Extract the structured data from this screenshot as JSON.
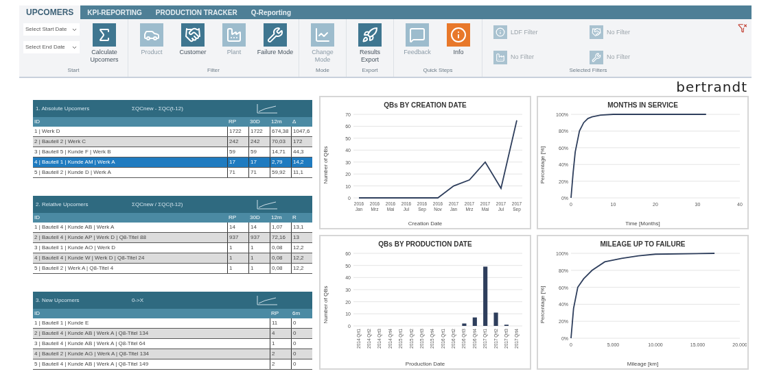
{
  "ribbon": {
    "tabs": [
      {
        "label": "UPCOMERS",
        "selected": true
      },
      {
        "label": "KPI-REPORTING",
        "selected": false
      },
      {
        "label": "PRODUCTION TRACKER",
        "selected": false
      },
      {
        "label": "Q-Reporting",
        "selected": false
      }
    ],
    "groups": [
      {
        "label": "Start",
        "dropdowns": [
          "Select Start Date",
          "Select End Date"
        ],
        "buttons": [
          {
            "label": "Calculate Upcomers",
            "disabled": false
          }
        ]
      },
      {
        "label": "Filter",
        "buttons": [
          {
            "label": "Product",
            "disabled": true
          },
          {
            "label": "Customer",
            "disabled": false
          },
          {
            "label": "Plant",
            "disabled": true
          },
          {
            "label": "Failure Mode",
            "disabled": false
          }
        ]
      },
      {
        "label": "Mode",
        "buttons": [
          {
            "label": "Change Mode",
            "disabled": true
          }
        ]
      },
      {
        "label": "Export",
        "buttons": [
          {
            "label": "Results Export",
            "disabled": false
          }
        ]
      },
      {
        "label": "Quick Steps",
        "buttons": [
          {
            "label": "Feedback",
            "disabled": true
          },
          {
            "label": "Info",
            "disabled": false
          }
        ]
      }
    ],
    "selected_filters": {
      "label": "Selected Filters",
      "items": [
        "LDF Filter",
        "No Filter",
        "No Filter",
        "No Filter"
      ]
    }
  },
  "logo": "bertrandt",
  "tables": [
    {
      "title": "1. Absolute Upcomers",
      "formula": "ΣQCnew - ΣQC(t-12)",
      "columns": [
        "ID",
        "RP",
        "30D",
        "12m",
        "Δ"
      ],
      "rows": [
        {
          "cells": [
            "1 | Werk D",
            "1722",
            "1722",
            "674,38",
            "1047,6"
          ],
          "selected": false
        },
        {
          "cells": [
            "2 | Bauteil 2 | Werk C",
            "242",
            "242",
            "70,03",
            "172"
          ],
          "selected": false
        },
        {
          "cells": [
            "3 | Bauteil 5 | Kunde F | Werk B",
            "59",
            "59",
            "14,71",
            "44,3"
          ],
          "selected": false
        },
        {
          "cells": [
            "4 | Bauteil 1 | Kunde AM | Werk A",
            "17",
            "17",
            "2,79",
            "14,2"
          ],
          "selected": true
        },
        {
          "cells": [
            "5 | Bauteil 2 | Kunde D | Werk A",
            "71",
            "71",
            "59,92",
            "11,1"
          ],
          "selected": false
        }
      ]
    },
    {
      "title": "2. Relative Upcomers",
      "formula": "ΣQCnew / ΣQC(t-12)",
      "columns": [
        "ID",
        "RP",
        "30D",
        "12m",
        "R"
      ],
      "rows": [
        {
          "cells": [
            "1 | Bauteil 4 | Kunde AB | Werk A",
            "14",
            "14",
            "1,07",
            "13,1"
          ],
          "selected": false
        },
        {
          "cells": [
            "2 | Bauteil 4 | Kunde AP | Werk D | Q8-Titel 88",
            "937",
            "937",
            "72,16",
            "13"
          ],
          "selected": false
        },
        {
          "cells": [
            "3 | Bauteil 1 | Kunde AO | Werk D",
            "1",
            "1",
            "0,08",
            "12,2"
          ],
          "selected": false
        },
        {
          "cells": [
            "4 | Bauteil 4 | Kunde W | Werk D | Q8-Titel 24",
            "1",
            "1",
            "0,08",
            "12,2"
          ],
          "selected": false
        },
        {
          "cells": [
            "5 | Bauteil 2 | Werk A | Q8-Titel 4",
            "1",
            "1",
            "0,08",
            "12,2"
          ],
          "selected": false
        }
      ]
    },
    {
      "title": "3. New Upcomers",
      "formula": "0->X",
      "columns": [
        "ID",
        "RP",
        "6m"
      ],
      "rows": [
        {
          "cells": [
            "1 | Bauteil 1 | Kunde E",
            "11",
            "0"
          ],
          "selected": false
        },
        {
          "cells": [
            "2 | Bauteil 4 | Kunde AB | Werk A | Q8-Titel 134",
            "4",
            "0"
          ],
          "selected": false
        },
        {
          "cells": [
            "3 | Bauteil 4 | Kunde AB | Werk A | Q8-Titel 64",
            "1",
            "0"
          ],
          "selected": false
        },
        {
          "cells": [
            "4 | Bauteil 2 | Kunde AG | Werk A | Q8-Titel 134",
            "2",
            "0"
          ],
          "selected": false
        },
        {
          "cells": [
            "5 | Bauteil 4 | Kunde AB | Werk A | Q8-Titel 149",
            "2",
            "0"
          ],
          "selected": false
        }
      ]
    }
  ],
  "charts": [
    {
      "chart_data": {
        "type": "line",
        "title": "QBs BY CREATION DATE",
        "xlabel": "Creation Date",
        "ylabel": "Number of QBs",
        "categories": [
          "2016 Jan",
          "2016 Mrz",
          "2016 Mai",
          "2016 Jul",
          "2016 Sep",
          "2016 Nov",
          "2017 Jan",
          "2017 Mrz",
          "2017 Mai",
          "2017 Jul",
          "2017 Sep"
        ],
        "values": [
          0,
          0,
          0,
          0,
          0,
          0,
          10,
          15,
          30,
          8,
          65
        ],
        "grid": true,
        "ylim": [
          0,
          70
        ],
        "yticks": [
          0,
          10,
          20,
          30,
          40,
          50,
          60,
          70
        ]
      }
    },
    {
      "chart_data": {
        "type": "line",
        "title": "MONTHS IN SERVICE",
        "xlabel": "Time [Months]",
        "ylabel": "Percentage [%]",
        "x": [
          0,
          0.5,
          1,
          2,
          3,
          4,
          5,
          7,
          10,
          20,
          32
        ],
        "values": [
          0,
          0.3,
          0.55,
          0.8,
          0.9,
          0.95,
          0.97,
          0.99,
          1,
          1,
          1
        ],
        "grid": true,
        "xlim": [
          0,
          40
        ],
        "xticks": [
          0,
          10,
          20,
          30,
          40
        ],
        "ylim": [
          0,
          1
        ],
        "yticks": [
          {
            "value": 0,
            "label": "0%"
          },
          {
            "value": 0.2,
            "label": "20%"
          },
          {
            "value": 0.4,
            "label": "40%"
          },
          {
            "value": 0.6,
            "label": "60%"
          },
          {
            "value": 0.8,
            "label": "80%"
          },
          {
            "value": 1,
            "label": "100%"
          }
        ]
      }
    },
    {
      "chart_data": {
        "type": "bar",
        "title": "QBs BY PRODUCTION DATE",
        "xlabel": "Production Date",
        "ylabel": "Number of QBs",
        "categories": [
          "2014 Qrt1",
          "2014 Qrt2",
          "2014 Qrt3",
          "2014 Qrt4",
          "2015 Qrt1",
          "2015 Qrt2",
          "2015 Qrt3",
          "2015 Qrt4",
          "2016 Qrt1",
          "2016 Qrt2",
          "2016 Qrt3",
          "2016 Qrt4",
          "2017 Qrt1",
          "2017 Qrt2",
          "2017 Qrt3",
          "2017 Qrt4"
        ],
        "values": [
          0,
          0,
          0,
          0,
          0,
          0,
          0,
          0,
          0,
          0,
          2,
          7,
          49,
          11,
          1,
          0
        ],
        "grid": true,
        "ylim": [
          0,
          60
        ],
        "yticks": [
          0,
          10,
          20,
          30,
          40,
          50,
          60
        ]
      }
    },
    {
      "chart_data": {
        "type": "line",
        "title": "MILEAGE UP TO FAILURE",
        "xlabel": "Mileage [km]",
        "ylabel": "Percentage [%]",
        "x": [
          0,
          300,
          800,
          1500,
          2500,
          4000,
          6000,
          8000,
          10000,
          17000
        ],
        "values": [
          0,
          0.35,
          0.6,
          0.7,
          0.8,
          0.9,
          0.94,
          0.97,
          0.99,
          1
        ],
        "grid": true,
        "xlim": [
          0,
          20000
        ],
        "xticks": [
          0,
          {
            "value": 5000,
            "label": "5.000"
          },
          {
            "value": 10000,
            "label": "10.000"
          },
          {
            "value": 15000,
            "label": "15.000"
          },
          {
            "value": 20000,
            "label": "20.000"
          }
        ],
        "ylim": [
          0,
          1
        ],
        "yticks": [
          {
            "value": 0,
            "label": "0%"
          },
          {
            "value": 0.2,
            "label": "20%"
          },
          {
            "value": 0.4,
            "label": "40%"
          },
          {
            "value": 0.6,
            "label": "60%"
          },
          {
            "value": 0.8,
            "label": "80%"
          },
          {
            "value": 1,
            "label": "100%"
          }
        ]
      }
    }
  ]
}
